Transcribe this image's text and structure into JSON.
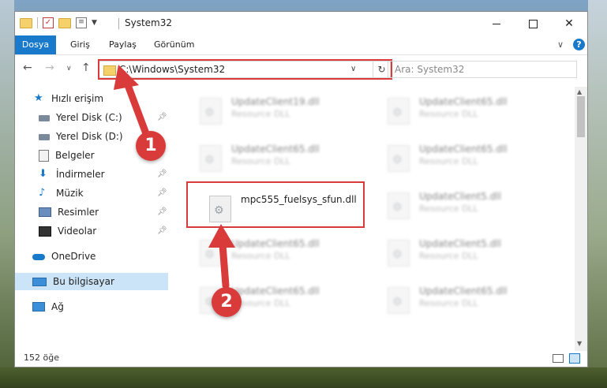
{
  "window": {
    "title": "System32",
    "minimize_label": "",
    "help_label": "?"
  },
  "ribbon": {
    "tabs": [
      "Dosya",
      "Giriş",
      "Paylaş",
      "Görünüm"
    ]
  },
  "address_bar": {
    "path": "C:\\Windows\\System32",
    "search_placeholder": "Ara: System32"
  },
  "sidebar": {
    "items": [
      {
        "label": "Hızlı erişim",
        "icon": "star-icon",
        "pinned": false
      },
      {
        "label": "Yerel Disk (C:)",
        "icon": "drive-icon",
        "pinned": true
      },
      {
        "label": "Yerel Disk (D:)",
        "icon": "drive-icon",
        "pinned": false
      },
      {
        "label": "Belgeler",
        "icon": "document-icon",
        "pinned": false
      },
      {
        "label": "İndirmeler",
        "icon": "download-icon",
        "pinned": true
      },
      {
        "label": "Müzik",
        "icon": "music-icon",
        "pinned": true
      },
      {
        "label": "Resimler",
        "icon": "pictures-icon",
        "pinned": true
      },
      {
        "label": "Videolar",
        "icon": "video-icon",
        "pinned": true
      },
      {
        "label": "OneDrive",
        "icon": "cloud-icon",
        "pinned": false
      },
      {
        "label": "Bu bilgisayar",
        "icon": "computer-icon",
        "pinned": false,
        "selected": true
      },
      {
        "label": "Ağ",
        "icon": "network-icon",
        "pinned": false
      }
    ]
  },
  "files": [
    {
      "name": "UpdateClient19.dll",
      "type": "Resource DLL",
      "blurred": true
    },
    {
      "name": "UpdateClient65.dll",
      "type": "Resource DLL",
      "blurred": true
    },
    {
      "name": "UpdateClient65.dll",
      "type": "Resource DLL",
      "blurred": true
    },
    {
      "name": "UpdateClient65.dll",
      "type": "Resource DLL",
      "blurred": true
    },
    {
      "name": "mpc555_fuelsys_sfun.dll",
      "type": "",
      "blurred": false
    },
    {
      "name": "UpdateClient5.dll",
      "type": "Resource DLL",
      "blurred": true
    },
    {
      "name": "UpdateClient65.dll",
      "type": "Resource DLL",
      "blurred": true
    },
    {
      "name": "UpdateClient5.dll",
      "type": "Resource DLL",
      "blurred": true
    },
    {
      "name": "UpdateClient65.dll",
      "type": "Resource DLL",
      "blurred": true
    },
    {
      "name": "UpdateClient65.dll",
      "type": "Resource DLL",
      "blurred": true
    }
  ],
  "status": {
    "item_count": "152 öğe"
  },
  "annotations": {
    "step1": "1",
    "step2": "2",
    "color": "#d93a3a"
  }
}
